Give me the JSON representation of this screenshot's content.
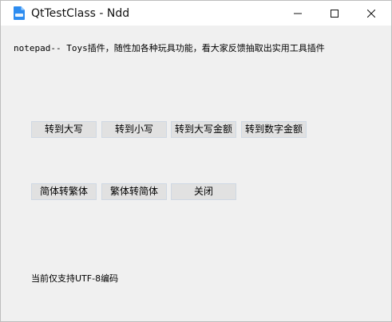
{
  "window": {
    "title": "QtTestClass - Ndd",
    "icon": "document-app-icon",
    "controls": {
      "minimize": "minimize-icon",
      "maximize": "maximize-icon",
      "close": "close-icon"
    }
  },
  "content": {
    "description": "notepad-- Toys插件，随性加各种玩具功能，看大家反馈抽取出实用工具插件",
    "row1": {
      "to_upper": "转到大写",
      "to_lower": "转到小写",
      "to_upper_amount": "转到大写金额",
      "to_digit_amount": "转到数字金额"
    },
    "row2": {
      "simp_to_trad": "简体转繁体",
      "trad_to_simp": "繁体转简体",
      "close": "关闭"
    },
    "status": "当前仅支持UTF-8编码"
  },
  "colors": {
    "window_bg": "#f0f0f0",
    "titlebar_bg": "#ffffff",
    "button_bg": "#e1e1e1",
    "button_border": "#cfd8e3",
    "icon_blue": "#2d8cf0"
  }
}
